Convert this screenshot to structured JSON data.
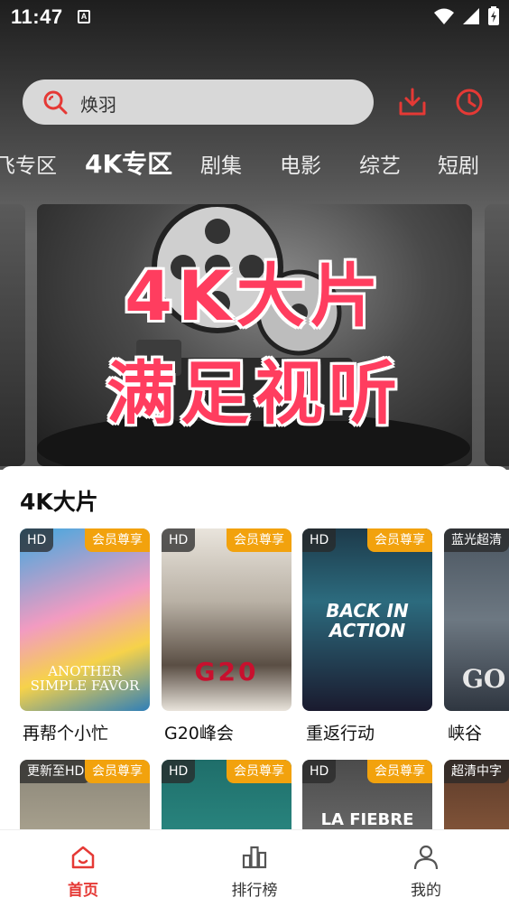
{
  "status_bar": {
    "time": "11:47",
    "indicator": "A"
  },
  "search": {
    "value": "焕羽",
    "icon": "search-icon"
  },
  "header_actions": {
    "download_icon": "download-icon",
    "history_icon": "history-icon"
  },
  "tabs": [
    {
      "label": "飞专区",
      "active": false
    },
    {
      "label": "4K专区",
      "active": true
    },
    {
      "label": "剧集",
      "active": false
    },
    {
      "label": "电影",
      "active": false
    },
    {
      "label": "综艺",
      "active": false
    },
    {
      "label": "短剧",
      "active": false
    }
  ],
  "banner": {
    "line1": "4K大片",
    "line2": "满足视听"
  },
  "section": {
    "title": "4K大片"
  },
  "posters_row1": [
    {
      "title": "再帮个小忙",
      "badge_left": "HD",
      "badge_right": "会员尊享",
      "art_text": "ANOTHER SIMPLE FAVOR"
    },
    {
      "title": "G20峰会",
      "badge_left": "HD",
      "badge_right": "会员尊享",
      "art_text": "G20"
    },
    {
      "title": "重返行动",
      "badge_left": "HD",
      "badge_right": "会员尊享",
      "art_text": "BACK IN ACTION"
    },
    {
      "title": "峡谷",
      "badge_left": "蓝光超清",
      "badge_right": "",
      "art_text": "GO"
    }
  ],
  "posters_row2": [
    {
      "badge_left": "更新至HD",
      "badge_right": "会员尊享"
    },
    {
      "badge_left": "HD",
      "badge_right": "会员尊享"
    },
    {
      "badge_left": "HD",
      "badge_right": "会员尊享",
      "art_text": "LA FIEBRE"
    },
    {
      "badge_left": "超清中字",
      "badge_right": ""
    }
  ],
  "bottom_nav": [
    {
      "label": "首页",
      "icon": "home-icon",
      "active": true
    },
    {
      "label": "排行榜",
      "icon": "ranking-icon",
      "active": false
    },
    {
      "label": "我的",
      "icon": "profile-icon",
      "active": false
    }
  ],
  "colors": {
    "accent": "#e53935",
    "badge": "#f2a20d",
    "banner_text": "#ff3d5f"
  }
}
